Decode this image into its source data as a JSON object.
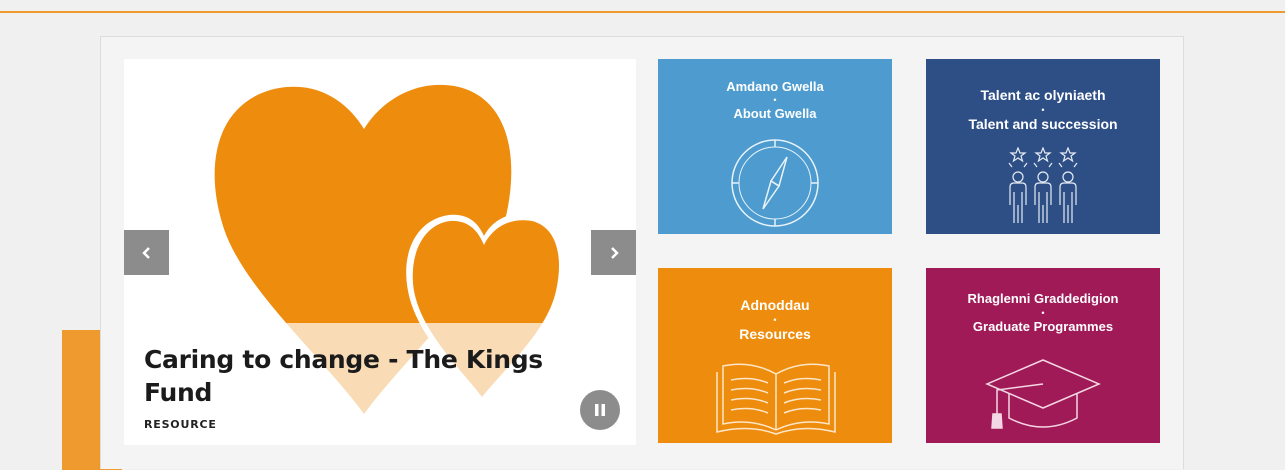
{
  "carousel": {
    "slide_title": "Caring to change - The Kings Fund",
    "slide_type": "RESOURCE",
    "prev_icon": "chevron-left-icon",
    "next_icon": "chevron-right-icon",
    "pause_icon": "pause-icon"
  },
  "tiles": [
    {
      "line1": "Amdano Gwella",
      "separator": "•",
      "line2": "About Gwella",
      "icon": "compass-icon",
      "color": "#4e9bcf"
    },
    {
      "line1": "Talent ac olyniaeth",
      "separator": "•",
      "line2": "Talent and succession",
      "icon": "people-stars-icon",
      "color": "#2e4f86"
    },
    {
      "line1": "Adnoddau",
      "separator": "•",
      "line2": "Resources",
      "icon": "open-book-icon",
      "color": "#ee8c0d"
    },
    {
      "line1": "Rhaglenni Graddedigion",
      "separator": "•",
      "line2": "Graduate Programmes",
      "icon": "graduation-cap-icon",
      "color": "#a11a58"
    }
  ],
  "colors": {
    "accent": "#ee9a2e",
    "heart": "#ee8c0d",
    "heart_tip": "#f9dcb6"
  }
}
